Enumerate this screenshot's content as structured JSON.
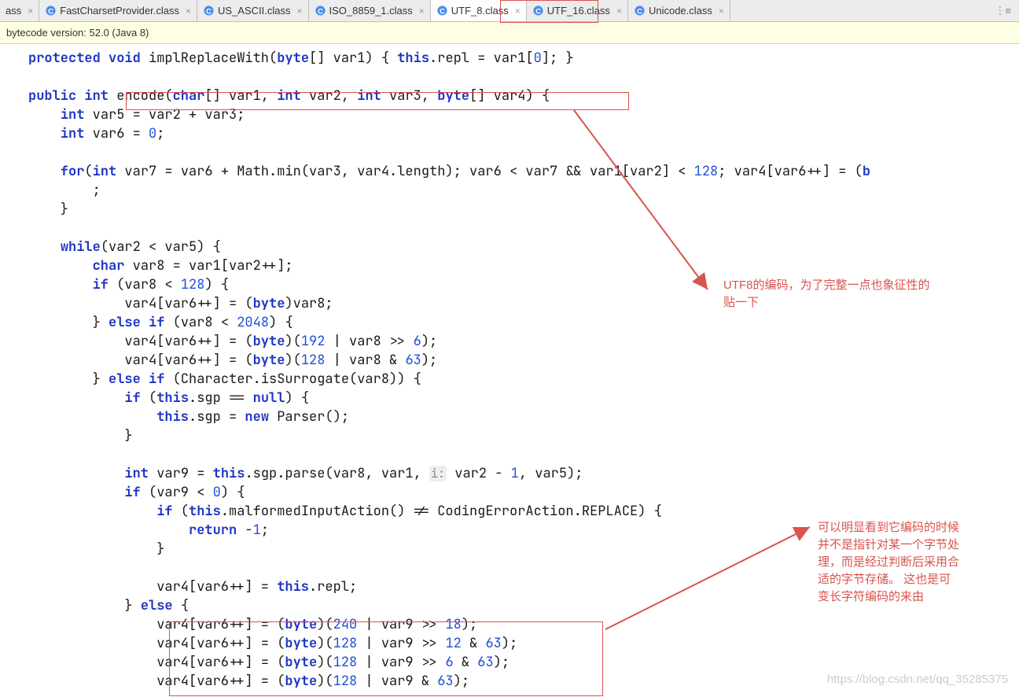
{
  "tabs": [
    {
      "label": "ass",
      "active": false,
      "noicon": true
    },
    {
      "label": "FastCharsetProvider.class",
      "active": false
    },
    {
      "label": "US_ASCII.class",
      "active": false
    },
    {
      "label": "ISO_8859_1.class",
      "active": false
    },
    {
      "label": "UTF_8.class",
      "active": true
    },
    {
      "label": "UTF_16.class",
      "active": false
    },
    {
      "label": "Unicode.class",
      "active": false
    }
  ],
  "banner": "bytecode version: 52.0 (Java 8)",
  "code": {
    "l01a": "protected void",
    "l01b": " implReplaceWith(",
    "l01c": "byte",
    "l01d": "[] var1) { ",
    "l01e": "this",
    "l01f": ".repl = var1[",
    "l01g": "0",
    "l01h": "]; }",
    "l02a": "public int",
    "l02b": " encode(",
    "l02c": "char",
    "l02d": "[] var1, ",
    "l02e": "int",
    "l02f": " var2, ",
    "l02g": "int",
    "l02h": " var3, ",
    "l02i": "byte",
    "l02j": "[] var4) {",
    "l03a": "int",
    "l03b": " var5 = var2 + var3;",
    "l04a": "int",
    "l04b": " var6 = ",
    "l04c": "0",
    "l04d": ";",
    "l05a": "for",
    "l05b": "(",
    "l05c": "int",
    "l05d": " var7 = var6 + Math.min(var3, var4.length); var6 < var7 && var1[var2] < ",
    "l05e": "128",
    "l05f": "; var4[var6++] = (",
    "l05g": "b",
    "l06a": "    ;",
    "l07a": "}",
    "l08a": "while",
    "l08b": "(var2 < var5) {",
    "l09a": "char",
    "l09b": " var8 = var1[var2++];",
    "l10a": "if",
    "l10b": " (var8 < ",
    "l10c": "128",
    "l10d": ") {",
    "l11a": "    var4[var6++] = (",
    "l11b": "byte",
    "l11c": ")var8;",
    "l12a": "} ",
    "l12b": "else if",
    "l12c": " (var8 < ",
    "l12d": "2048",
    "l12e": ") {",
    "l13a": "    var4[var6++] = (",
    "l13b": "byte",
    "l13c": ")(",
    "l13d": "192",
    "l13e": " | var8 >> ",
    "l13f": "6",
    "l13g": ");",
    "l14a": "    var4[var6++] = (",
    "l14b": "byte",
    "l14c": ")(",
    "l14d": "128",
    "l14e": " | var8 & ",
    "l14f": "63",
    "l14g": ");",
    "l15a": "} ",
    "l15b": "else if",
    "l15c": " (Character.isSurrogate(var8)) {",
    "l16a": "if",
    "l16b": " (",
    "l16c": "this",
    "l16d": ".sgp == ",
    "l16e": "null",
    "l16f": ") {",
    "l17a": "this",
    "l17b": ".sgp = ",
    "l17c": "new",
    "l17d": " Parser();",
    "l18a": "}",
    "l19a": "int",
    "l19b": " var9 = ",
    "l19c": "this",
    "l19d": ".sgp.parse(var8, var1, ",
    "l19hint": "i:",
    "l19e": " var2 - ",
    "l19f": "1",
    "l19g": ", var5);",
    "l20a": "if",
    "l20b": " (var9 < ",
    "l20c": "0",
    "l20d": ") {",
    "l21a": "if",
    "l21b": " (",
    "l21c": "this",
    "l21d": ".malformedInputAction() != CodingErrorAction.REPLACE) {",
    "l22a": "return",
    "l22b": " -",
    "l22c": "1",
    "l22d": ";",
    "l23a": "}",
    "l24a": "var4[var6++] = ",
    "l24b": "this",
    "l24c": ".repl;",
    "l25a": "} ",
    "l25b": "else",
    "l25c": " {",
    "l26a": "var4[var6++] = (",
    "l26b": "byte",
    "l26c": ")(",
    "l26d": "240",
    "l26e": " | var9 >> ",
    "l26f": "18",
    "l26g": ");",
    "l27a": "var4[var6++] = (",
    "l27b": "byte",
    "l27c": ")(",
    "l27d": "128",
    "l27e": " | var9 >> ",
    "l27f": "12",
    "l27g": " & ",
    "l27h": "63",
    "l27i": ");",
    "l28a": "var4[var6++] = (",
    "l28b": "byte",
    "l28c": ")(",
    "l28d": "128",
    "l28e": " | var9 >> ",
    "l28f": "6",
    "l28g": " & ",
    "l28h": "63",
    "l28i": ");",
    "l29a": "var4[var6++] = (",
    "l29b": "byte",
    "l29c": ")(",
    "l29d": "128",
    "l29e": " | var9 & ",
    "l29f": "63",
    "l29g": ");"
  },
  "annot1_l1": "UTF8的编码，为了完整一点也象征性的",
  "annot1_l2": "贴一下",
  "annot2_l1": "可以明显看到它编码的时候",
  "annot2_l2": "并不是指针对某一个字节处",
  "annot2_l3": "理，而是经过判断后采用合",
  "annot2_l4": "适的字节存储。 这也是可",
  "annot2_l5": "变长字符编码的来由",
  "watermark": "https://blog.csdn.net/qq_35285375"
}
